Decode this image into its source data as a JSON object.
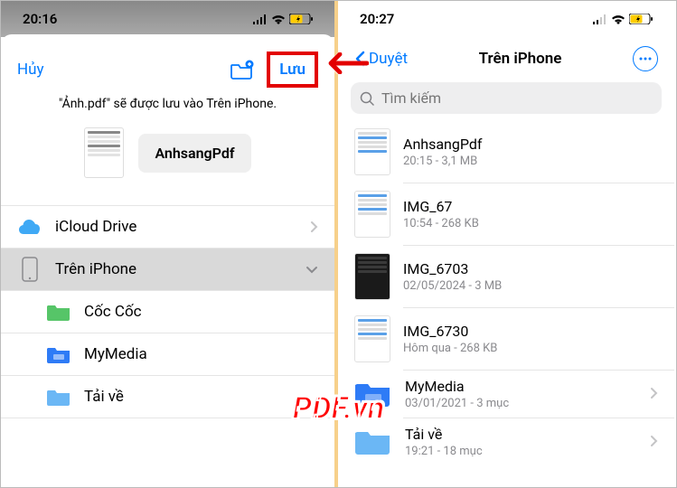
{
  "left": {
    "time": "20:16",
    "cancel": "Hủy",
    "save": "Lưu",
    "info": "\"Ảnh.pdf\" sẽ được lưu vào Trên iPhone.",
    "filename": "AnhsangPdf",
    "locations": [
      {
        "label": "iCloud Drive",
        "type": "icloud",
        "chev": "right",
        "indent": false
      },
      {
        "label": "Trên iPhone",
        "type": "iphone",
        "chev": "down",
        "indent": false,
        "selected": true
      },
      {
        "label": "Cốc Cốc",
        "type": "folder-green",
        "chev": "none",
        "indent": true
      },
      {
        "label": "MyMedia",
        "type": "folder-blue",
        "chev": "none",
        "indent": true
      },
      {
        "label": "Tải về",
        "type": "folder-light",
        "chev": "none",
        "indent": true
      }
    ]
  },
  "right": {
    "time": "20:27",
    "back": "Duyệt",
    "title": "Trên iPhone",
    "search_placeholder": "Tìm kiếm",
    "files": [
      {
        "name": "AnhsangPdf",
        "meta": "20:15 - 3,1 MB",
        "thumb": "doc",
        "chev": false
      },
      {
        "name": "IMG_67",
        "meta": "10:54 - 268 KB",
        "thumb": "img",
        "chev": false
      },
      {
        "name": "IMG_6703",
        "meta": "02/05/2024 - 3 MB",
        "thumb": "dark",
        "chev": false
      },
      {
        "name": "IMG_6730",
        "meta": "Hôm qua - 268 KB",
        "thumb": "img",
        "chev": false
      },
      {
        "name": "MyMedia",
        "meta": "03/01/2021 - 3 mục",
        "thumb": "folder",
        "chev": true
      },
      {
        "name": "Tải về",
        "meta": "19:21 - 18 mục",
        "thumb": "folder-light",
        "chev": true
      }
    ]
  },
  "watermark": "PDF.vn"
}
